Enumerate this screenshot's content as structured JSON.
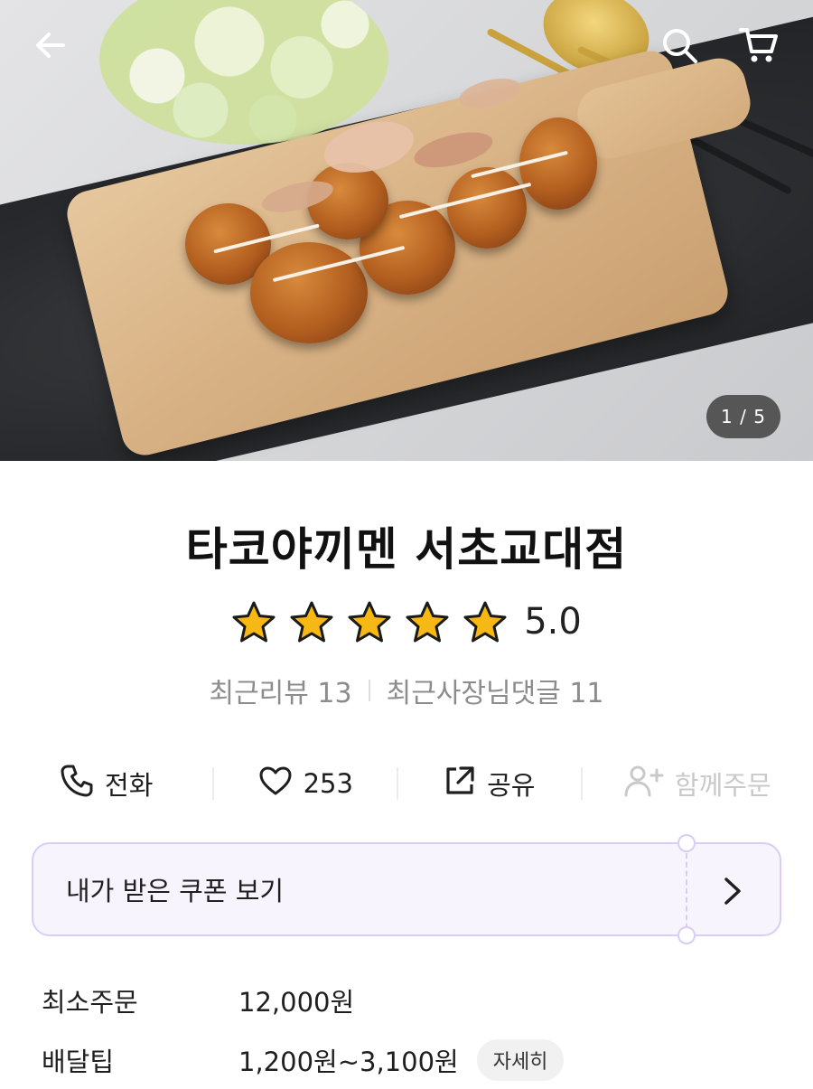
{
  "hero": {
    "counter": "1 / 5",
    "icons": {
      "back": "arrow-left-icon",
      "search": "search-icon",
      "cart": "cart-icon"
    }
  },
  "store": {
    "name": "타코야끼멘 서초교대점",
    "rating": 5.0,
    "rating_text": "5.0",
    "stars_filled": 5,
    "stars_total": 5,
    "star_color": "#f7b814",
    "recent_reviews": "최근리뷰 13",
    "recent_owner_replies": "최근사장님댓글 11"
  },
  "actions": [
    {
      "label": "전화",
      "icon": "phone-icon",
      "enabled": true
    },
    {
      "label": "253",
      "icon": "heart-icon",
      "enabled": true
    },
    {
      "label": "공유",
      "icon": "share-icon",
      "enabled": true
    },
    {
      "label": "함께주문",
      "icon": "add-user-icon",
      "enabled": false
    }
  ],
  "coupon": {
    "label": "내가 받은 쿠폰 보기",
    "accent": "#d9cdf4",
    "background": "#f7f4fe"
  },
  "details": [
    {
      "label": "최소주문",
      "value": "12,000원"
    },
    {
      "label": "배달팁",
      "value": "1,200원~3,100원",
      "chip": "자세히"
    }
  ]
}
